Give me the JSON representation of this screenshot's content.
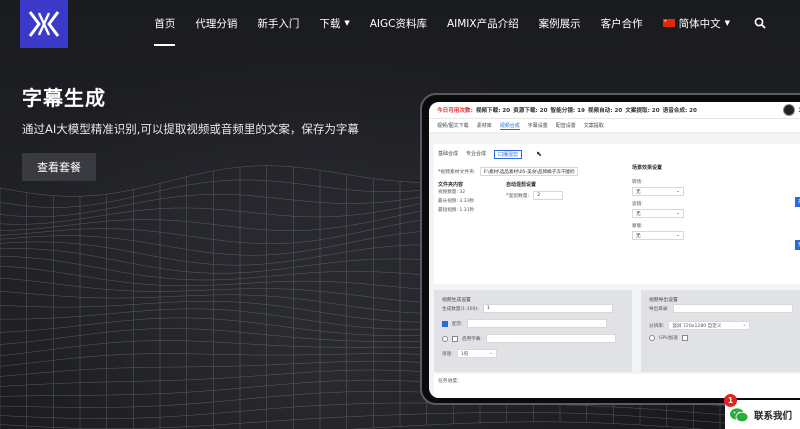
{
  "nav": {
    "items": [
      {
        "label": "首页",
        "active": true
      },
      {
        "label": "代理分销"
      },
      {
        "label": "新手入门"
      },
      {
        "label": "下载"
      },
      {
        "label": "AIGC资料库"
      },
      {
        "label": "AIMIX产品介绍"
      },
      {
        "label": "案例展示"
      },
      {
        "label": "客户合作"
      },
      {
        "label": "简体中文"
      }
    ]
  },
  "hero": {
    "title": "字幕生成",
    "subtitle": "通过AI大模型精准识别,可以提取视频或音频里的文案，保存为字幕",
    "cta": "查看套餐"
  },
  "app": {
    "stat_highlight": "今日可用次数:",
    "stats": [
      "视频下载: 20",
      "资源下载: 20",
      "智能分镜: 19",
      "视频自动: 20",
      "文案提取: 20",
      "语音合成: 20"
    ],
    "user_id": "17682",
    "tabs1": [
      "视频/图文下载",
      "素材库",
      "视频合成",
      "字幕设置",
      "配音设置",
      "文案提取"
    ],
    "tabs2": [
      "基础合成",
      "专业合成",
      "口播混剪"
    ],
    "folder_label": "*视频素材文件夹:",
    "folder_value": "F:\\素材\\选品素材\\05-美食\\品牌橘子冻干酸奶",
    "file_section": "文件夹内容",
    "file_info": [
      "视频数量: 32",
      "最长视频: 3.33秒",
      "最短视频: 1.31秒"
    ],
    "auto_section": "自动混剪设置",
    "count_label": "*混剪数量:",
    "count_value": "2",
    "effects_title": "场景效果设置",
    "transition_label": "转场:",
    "filter_label": "滤镜:",
    "mask_label": "蒙版:",
    "none": "无",
    "start_button": "开始",
    "preview_button": "预览",
    "gen_section": "视频生成设置",
    "gen_count_label": "生成数量(1-100):",
    "gen_count_value": "1",
    "voice_label": "配音:",
    "subtitle_label": "启用字幕:",
    "speed_label": "语速:",
    "speed_value": "1倍",
    "output_section": "视频导出设置",
    "output_dir_label": "导出目录:",
    "resolution_label": "分辨率:",
    "resolution_value": "竖屏 720x1280 自定义",
    "gpu_label": "GPU加速",
    "task_label": "任务进度:"
  },
  "contact": {
    "label": "联系我们",
    "badge": "1"
  }
}
